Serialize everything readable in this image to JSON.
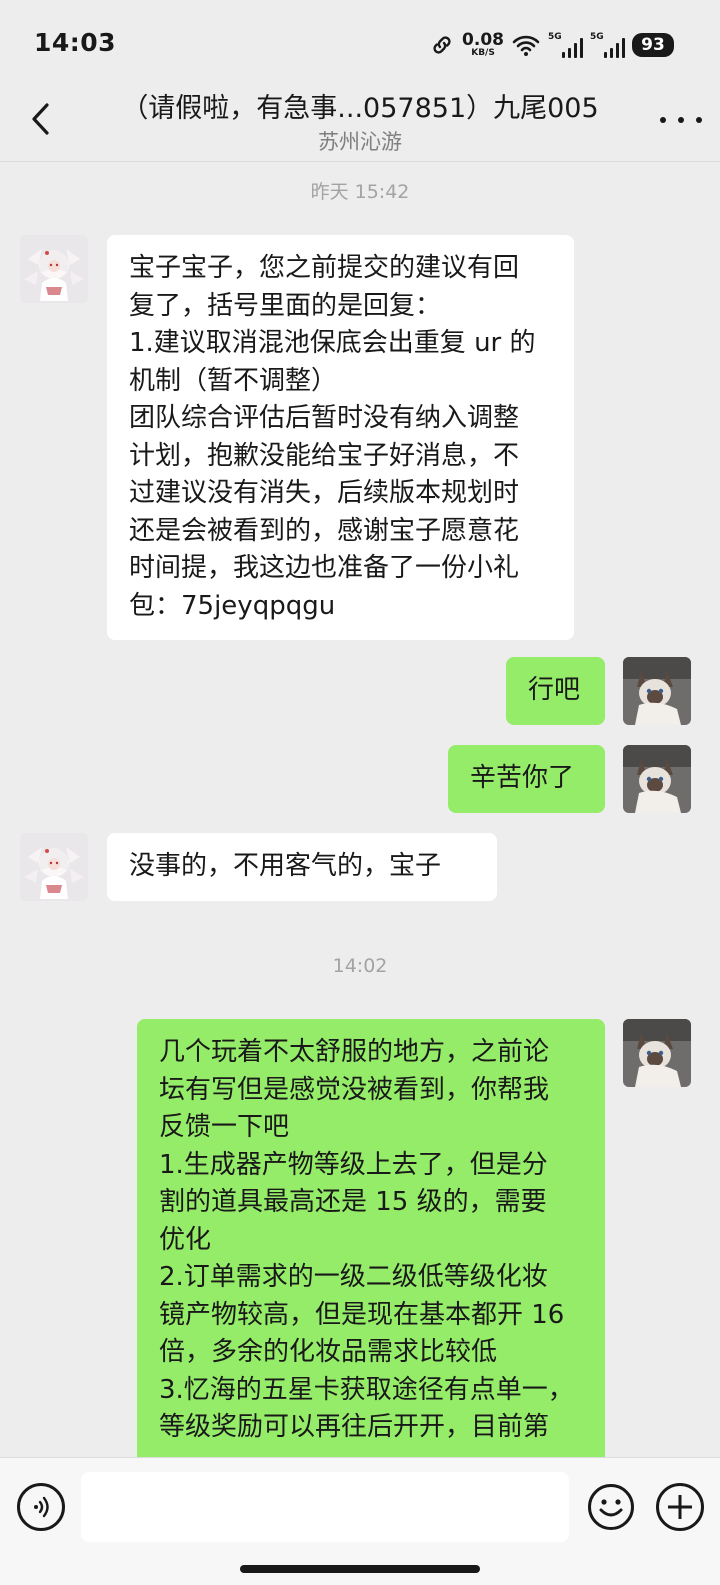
{
  "status_bar": {
    "time": "14:03",
    "net_speed_value": "0.08",
    "net_speed_unit": "KB/S",
    "signal1_label": "5G",
    "signal2_label": "5G",
    "battery": "93"
  },
  "header": {
    "title": "（请假啦，有急事...057851）九尾005",
    "subtitle": "苏州沁游"
  },
  "messages": {
    "ts1": "昨天 15:42",
    "m1": {
      "sender": "service",
      "lines": [
        "宝子宝子，您之前提交的建议有回",
        "复了，括号里面的是回复：",
        "1.建议取消混池保底会出重复 ur 的",
        "机制（暂不调整）",
        "团队综合评估后暂时没有纳入调整",
        "计划，抱歉没能给宝子好消息，不",
        "过建议没有消失，后续版本规划时",
        "还是会被看到的，感谢宝子愿意花",
        "时间提，我这边也准备了一份小礼",
        "包：75jeyqpqgu"
      ]
    },
    "m2": {
      "sender": "me",
      "text": "行吧"
    },
    "m3": {
      "sender": "me",
      "text": "辛苦你了"
    },
    "m4": {
      "sender": "service",
      "text": "没事的，不用客气的，宝子"
    },
    "ts2": "14:02",
    "m5": {
      "sender": "me",
      "lines": [
        "几个玩着不太舒服的地方，之前论",
        "坛有写但是感觉没被看到，你帮我",
        "反馈一下吧",
        "1.生成器产物等级上去了，但是分",
        "割的道具最高还是 15 级的，需要",
        "优化",
        "2.订单需求的一级二级低等级化妆",
        "镜产物较高，但是现在基本都开 16",
        "倍，多余的化妆品需求比较低",
        "3.忆海的五星卡获取途径有点单一，",
        "等级奖励可以再往后开开，目前第"
      ]
    }
  },
  "input": {
    "placeholder": ""
  },
  "icons": {
    "back": "chevron-left-icon",
    "more": "more-dots-icon",
    "voice": "voice-icon",
    "emoji": "emoji-icon",
    "plus": "plus-icon"
  },
  "colors": {
    "background": "#ededed",
    "incoming_bubble": "#ffffff",
    "outgoing_bubble": "#95ec69"
  }
}
